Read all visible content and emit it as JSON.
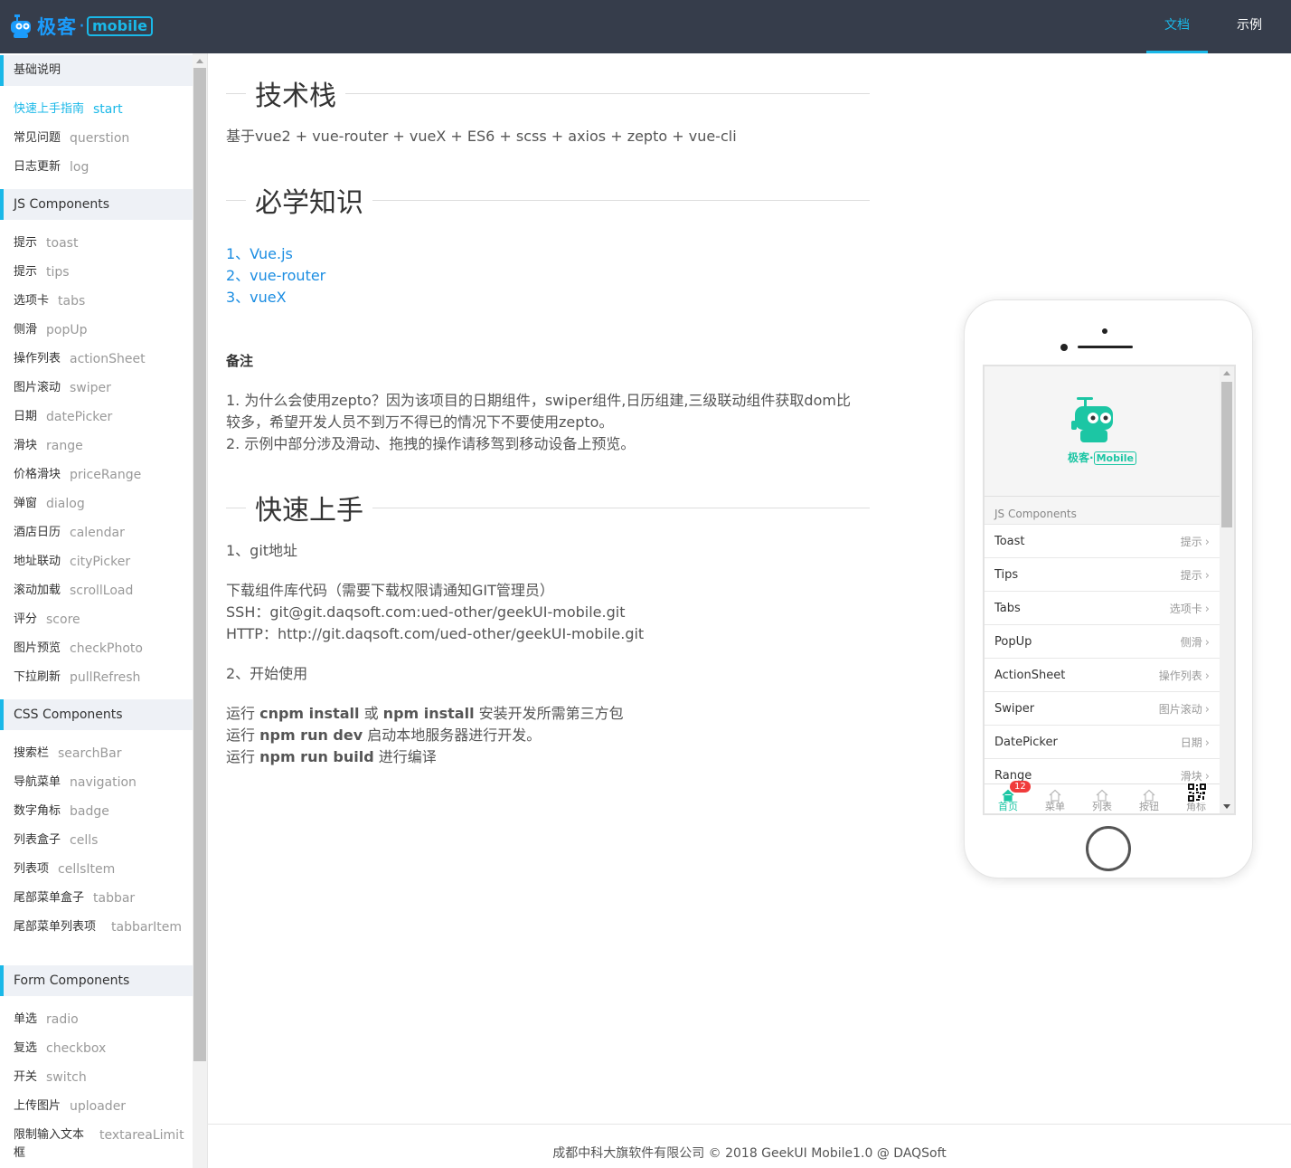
{
  "header": {
    "logo_text": "极客",
    "logo_dot": "·",
    "logo_badge": "mobile",
    "nav": [
      {
        "label": "文档",
        "active": true
      },
      {
        "label": "示例",
        "active": false
      }
    ]
  },
  "sidebar": {
    "groups": [
      {
        "title": "基础说明",
        "items": [
          {
            "zh": "快速上手指南",
            "en": "start",
            "active": true
          },
          {
            "zh": "常见问题",
            "en": "querstion"
          },
          {
            "zh": "日志更新",
            "en": "log"
          }
        ]
      },
      {
        "title": "JS Components",
        "items": [
          {
            "zh": "提示",
            "en": "toast"
          },
          {
            "zh": "提示",
            "en": "tips"
          },
          {
            "zh": "选项卡",
            "en": "tabs"
          },
          {
            "zh": "侧滑",
            "en": "popUp"
          },
          {
            "zh": "操作列表",
            "en": "actionSheet"
          },
          {
            "zh": "图片滚动",
            "en": "swiper"
          },
          {
            "zh": "日期",
            "en": "datePicker"
          },
          {
            "zh": "滑块",
            "en": "range"
          },
          {
            "zh": "价格滑块",
            "en": "priceRange"
          },
          {
            "zh": "弹窗",
            "en": "dialog"
          },
          {
            "zh": "酒店日历",
            "en": "calendar"
          },
          {
            "zh": "地址联动",
            "en": "cityPicker"
          },
          {
            "zh": "滚动加载",
            "en": "scrollLoad"
          },
          {
            "zh": "评分",
            "en": "score"
          },
          {
            "zh": "图片预览",
            "en": "checkPhoto"
          },
          {
            "zh": "下拉刷新",
            "en": "pullRefresh"
          }
        ]
      },
      {
        "title": "CSS Components",
        "items": [
          {
            "zh": "搜索栏",
            "en": "searchBar"
          },
          {
            "zh": "导航菜单",
            "en": "navigation"
          },
          {
            "zh": "数字角标",
            "en": "badge"
          },
          {
            "zh": "列表盒子",
            "en": "cells"
          },
          {
            "zh": "列表项",
            "en": "cellsItem"
          },
          {
            "zh": "尾部菜单盒子",
            "en": "tabbar"
          },
          {
            "zh": "尾部菜单列表项",
            "en": "tabbarItem",
            "wrap": true
          }
        ]
      },
      {
        "title": "Form Components",
        "items": [
          {
            "zh": "单选",
            "en": "radio"
          },
          {
            "zh": "复选",
            "en": "checkbox"
          },
          {
            "zh": "开关",
            "en": "switch"
          },
          {
            "zh": "上传图片",
            "en": "uploader"
          },
          {
            "zh": "限制输入文本框",
            "en": "textareaLimit",
            "wrap": true
          }
        ]
      }
    ]
  },
  "content": {
    "section1_title": "技术栈",
    "tech_stack": "基于vue2 + vue-router + vueX + ES6 + scss + axios + zepto + vue-cli",
    "section2_title": "必学知识",
    "links": [
      "1、Vue.js",
      "2、vue-router",
      "3、vueX"
    ],
    "note_title": "备注",
    "note_lines": [
      "1. 为什么会使用zepto？因为该项目的日期组件，swiper组件,日历组建,三级联动组件获取dom比较多，希望开发人员不到万不得已的情况下不要使用zepto。",
      "2. 示例中部分涉及滑动、拖拽的操作请移驾到移动设备上预览。"
    ],
    "section3_title": "快速上手",
    "step1": "1、git地址",
    "download_lines": [
      "下载组件库代码（需要下载权限请通知GIT管理员）",
      "SSH：git@git.daqsoft.com:ued-other/geekUI-mobile.git",
      "HTTP：http://git.daqsoft.com/ued-other/geekUI-mobile.git"
    ],
    "step2": "2、开始使用",
    "run_lines": [
      {
        "pre": "运行 ",
        "cmd": "cnpm install",
        "mid": " 或 ",
        "cmd2": "npm install",
        "post": " 安装开发所需第三方包"
      },
      {
        "pre": "运行 ",
        "cmd": "npm run dev",
        "mid": "",
        "cmd2": "",
        "post": " 启动本地服务器进行开发。"
      },
      {
        "pre": "运行 ",
        "cmd": "npm run build",
        "mid": "",
        "cmd2": "",
        "post": " 进行编译"
      }
    ]
  },
  "footer": {
    "text": "成都中科大旗软件有限公司 © 2018 GeekUI Mobile1.0 @ DAQSoft"
  },
  "phone": {
    "logo_text": "极客·",
    "logo_badge": "Mobile",
    "group_title": "JS Components",
    "cells": [
      {
        "title": "Toast",
        "desc": "提示"
      },
      {
        "title": "Tips",
        "desc": "提示"
      },
      {
        "title": "Tabs",
        "desc": "选项卡"
      },
      {
        "title": "PopUp",
        "desc": "侧滑"
      },
      {
        "title": "ActionSheet",
        "desc": "操作列表"
      },
      {
        "title": "Swiper",
        "desc": "图片滚动"
      },
      {
        "title": "DatePicker",
        "desc": "日期"
      },
      {
        "title": "Range",
        "desc": "滑块"
      }
    ],
    "tabbar": [
      {
        "label": "首页",
        "active": true,
        "badge": "12"
      },
      {
        "label": "菜单"
      },
      {
        "label": "列表"
      },
      {
        "label": "按钮"
      },
      {
        "label": "角标"
      }
    ]
  },
  "colors": {
    "header_bg": "#363d4b",
    "accent": "#1ab8e8",
    "link": "#1b8de2",
    "app_accent": "#1cc6a4",
    "badge": "#f03c3c"
  }
}
